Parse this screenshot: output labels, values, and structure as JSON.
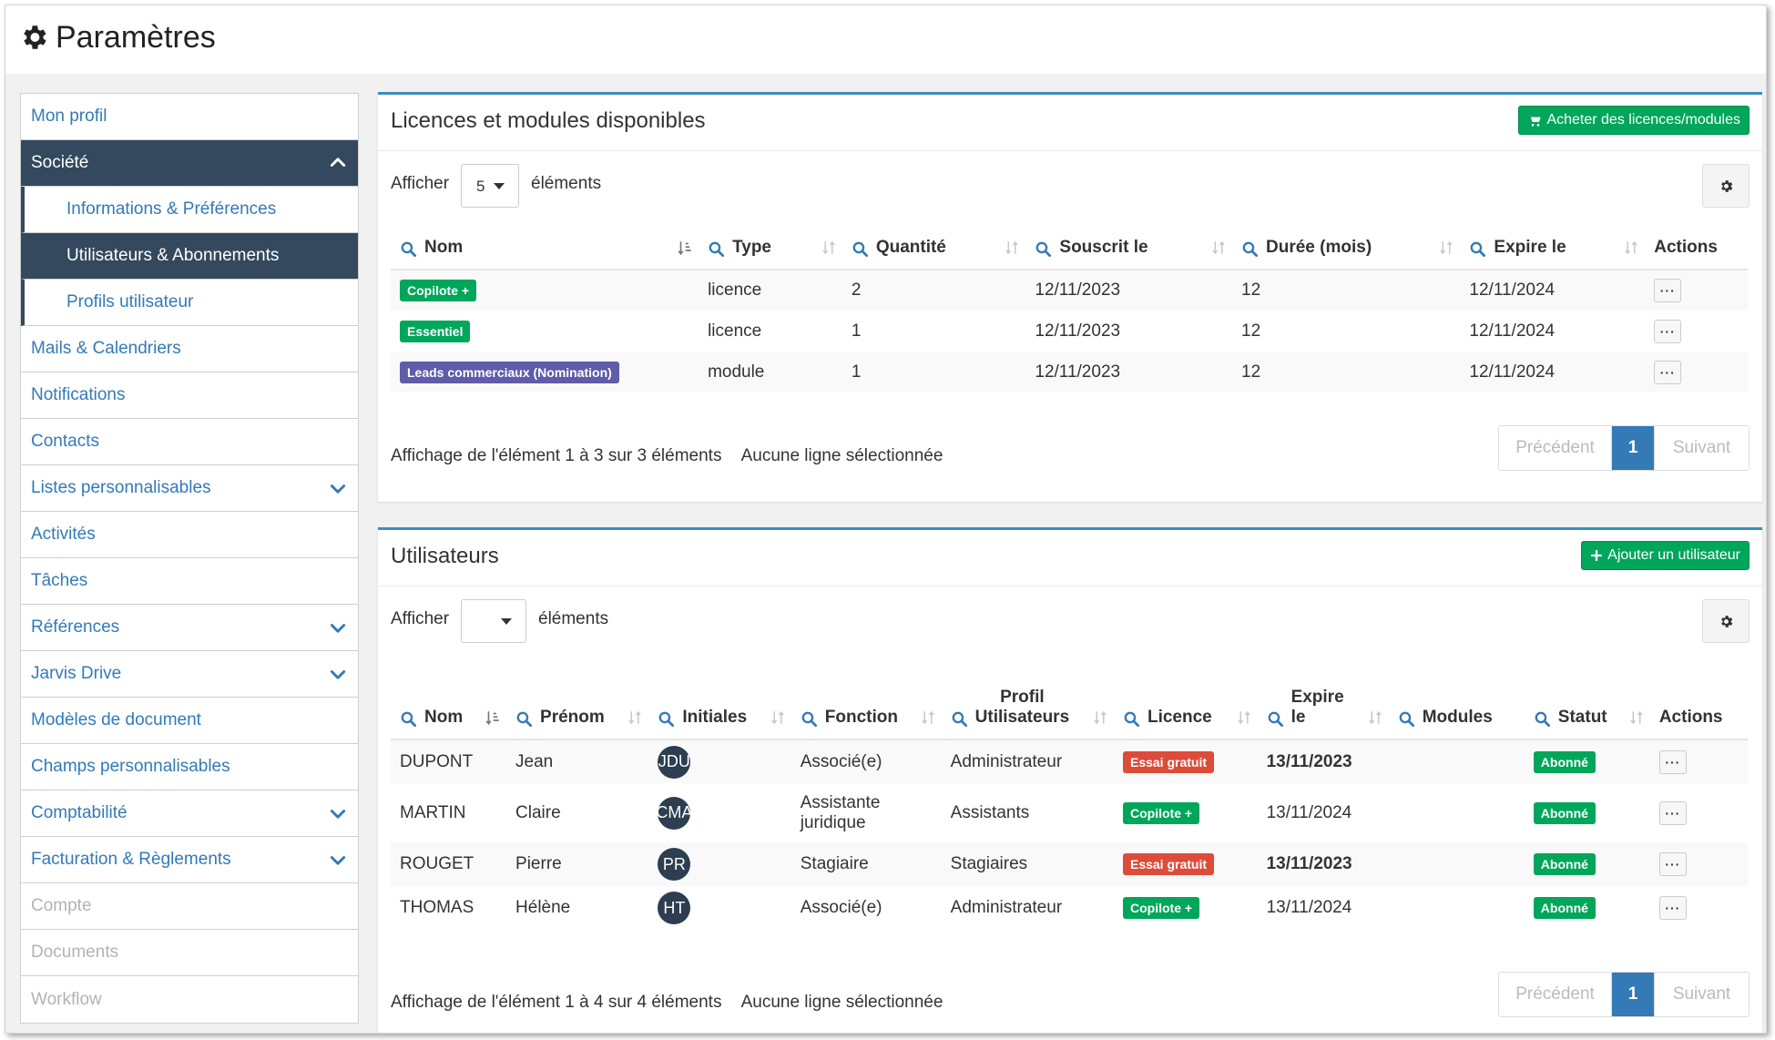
{
  "page": {
    "title": "Paramètres"
  },
  "sidebar": {
    "items": [
      {
        "label": "Mon profil",
        "state": "normal",
        "chevron": ""
      },
      {
        "label": "Société",
        "state": "active",
        "chevron": "up"
      },
      {
        "label": "Informations & Préférences",
        "state": "sub",
        "chevron": ""
      },
      {
        "label": "Utilisateurs & Abonnements",
        "state": "sub-active",
        "chevron": ""
      },
      {
        "label": "Profils utilisateur",
        "state": "sub",
        "chevron": ""
      },
      {
        "label": "Mails & Calendriers",
        "state": "normal",
        "chevron": ""
      },
      {
        "label": "Notifications",
        "state": "normal",
        "chevron": ""
      },
      {
        "label": "Contacts",
        "state": "normal",
        "chevron": ""
      },
      {
        "label": "Listes personnalisables",
        "state": "normal",
        "chevron": "down"
      },
      {
        "label": "Activités",
        "state": "normal",
        "chevron": ""
      },
      {
        "label": "Tâches",
        "state": "normal",
        "chevron": ""
      },
      {
        "label": "Références",
        "state": "normal",
        "chevron": "down"
      },
      {
        "label": "Jarvis Drive",
        "state": "normal",
        "chevron": "down"
      },
      {
        "label": "Modèles de document",
        "state": "normal",
        "chevron": ""
      },
      {
        "label": "Champs personnalisables",
        "state": "normal",
        "chevron": ""
      },
      {
        "label": "Comptabilité",
        "state": "normal",
        "chevron": "down"
      },
      {
        "label": "Facturation & Règlements",
        "state": "normal",
        "chevron": "down"
      },
      {
        "label": "Compte",
        "state": "disabled",
        "chevron": ""
      },
      {
        "label": "Documents",
        "state": "disabled",
        "chevron": ""
      },
      {
        "label": "Workflow",
        "state": "disabled",
        "chevron": ""
      }
    ]
  },
  "licences": {
    "title": "Licences et modules disponibles",
    "buy_label": "Acheter des licences/modules",
    "show_label": "Afficher",
    "show_value": "5",
    "elements_label": "éléments",
    "columns": [
      "Nom",
      "Type",
      "Quantité",
      "Souscrit le",
      "Durée (mois)",
      "Expire le",
      "Actions"
    ],
    "rows": [
      {
        "name": "Copilote +",
        "badge": "green",
        "type": "licence",
        "qty": "2",
        "subscribed": "12/11/2023",
        "duration": "12",
        "expires": "12/11/2024"
      },
      {
        "name": "Essentiel",
        "badge": "green",
        "type": "licence",
        "qty": "1",
        "subscribed": "12/11/2023",
        "duration": "12",
        "expires": "12/11/2024"
      },
      {
        "name": "Leads commerciaux (Nomination)",
        "badge": "purple",
        "type": "module",
        "qty": "1",
        "subscribed": "12/11/2023",
        "duration": "12",
        "expires": "12/11/2024"
      }
    ],
    "info": "Affichage de l'élément 1 à 3 sur 3 éléments",
    "selection": "Aucune ligne sélectionnée",
    "pager": {
      "prev": "Précédent",
      "current": "1",
      "next": "Suivant"
    }
  },
  "users": {
    "title": "Utilisateurs",
    "add_label": "Ajouter un utilisateur",
    "show_label": "Afficher",
    "show_value": "",
    "elements_label": "éléments",
    "columns": [
      {
        "top": "",
        "bottom": "Nom"
      },
      {
        "top": "",
        "bottom": "Prénom"
      },
      {
        "top": "",
        "bottom": "Initiales"
      },
      {
        "top": "",
        "bottom": "Fonction"
      },
      {
        "top": "Profil",
        "bottom": "Utilisateurs"
      },
      {
        "top": "",
        "bottom": "Licence"
      },
      {
        "top": "Expire",
        "bottom": "le"
      },
      {
        "top": "",
        "bottom": "Modules"
      },
      {
        "top": "",
        "bottom": "Statut"
      },
      {
        "top": "",
        "bottom": "Actions"
      }
    ],
    "rows": [
      {
        "nom": "DUPONT",
        "prenom": "Jean",
        "initiales": "JDU",
        "fonction": "Associé(e)",
        "profil": "Administrateur",
        "licence": "Essai gratuit",
        "licence_color": "red",
        "expire": "13/11/2023",
        "expire_bold": true,
        "statut": "Abonné"
      },
      {
        "nom": "MARTIN",
        "prenom": "Claire",
        "initiales": "CMA",
        "fonction": "Assistante juridique",
        "profil": "Assistants",
        "licence": "Copilote +",
        "licence_color": "green",
        "expire": "13/11/2024",
        "expire_bold": false,
        "statut": "Abonné"
      },
      {
        "nom": "ROUGET",
        "prenom": "Pierre",
        "initiales": "PR",
        "fonction": "Stagiaire",
        "profil": "Stagiaires",
        "licence": "Essai gratuit",
        "licence_color": "red",
        "expire": "13/11/2023",
        "expire_bold": true,
        "statut": "Abonné"
      },
      {
        "nom": "THOMAS",
        "prenom": "Hélène",
        "initiales": "HT",
        "fonction": "Associé(e)",
        "profil": "Administrateur",
        "licence": "Copilote +",
        "licence_color": "green",
        "expire": "13/11/2024",
        "expire_bold": false,
        "statut": "Abonné"
      }
    ],
    "info": "Affichage de l'élément 1 à 4 sur 4 éléments",
    "selection": "Aucune ligne sélectionnée",
    "pager": {
      "prev": "Précédent",
      "current": "1",
      "next": "Suivant"
    }
  },
  "colors": {
    "accent": "#3c8dbc",
    "nav_active": "#34495e",
    "green": "#00a65a",
    "purple": "#605ca8",
    "red": "#dd4b39",
    "link": "#337ab7"
  },
  "icons": {
    "title": "gear-icon",
    "search": "search-icon",
    "sort": "sort-icon",
    "cart": "cart-icon",
    "plus": "plus-icon",
    "chevron_up": "chevron-up-icon",
    "chevron_down": "chevron-down-icon",
    "more": "more-icon"
  }
}
